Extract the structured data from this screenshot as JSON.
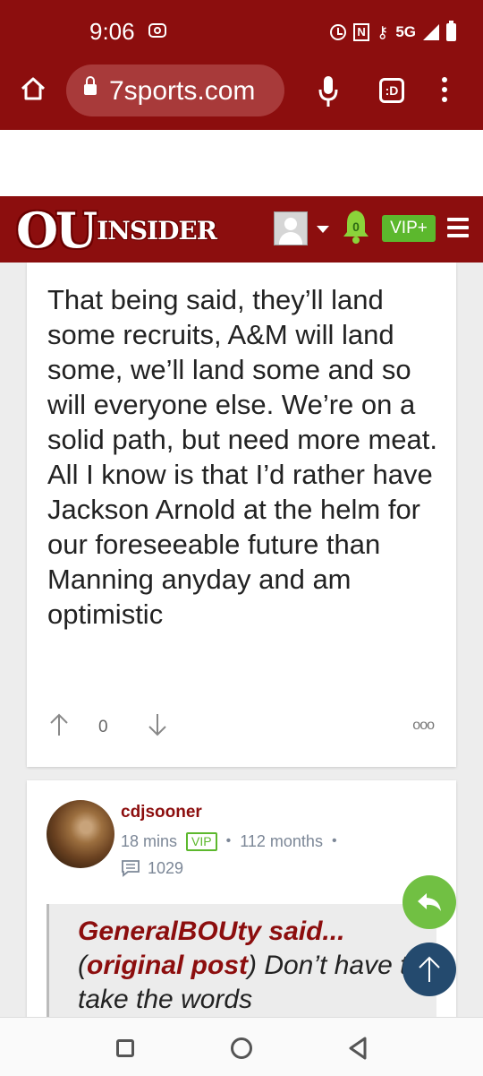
{
  "status_bar": {
    "time": "9:06",
    "network": "5G"
  },
  "browser": {
    "url": "7sports.com",
    "tab_icon_label": ":D"
  },
  "site_header": {
    "logo_ou": "OU",
    "logo_insider": "INSIDER",
    "notification_count": "0",
    "vip_label": "VIP+"
  },
  "post1": {
    "body": "That being said, they’ll land some recruits, A&M will land some, we’ll land some and so will everyone else. We’re on a solid path, but need more meat. All I know is that I’d rather have Jackson Arnold at the helm for our foreseeable future than Manning anyday and am optimistic",
    "vote_count": "0",
    "more_label": "ooo"
  },
  "post2": {
    "author": "cdjsooner",
    "time_ago": "18 mins",
    "vip_tag": "VIP",
    "member_duration": "112 months",
    "post_count": "1029",
    "quote": {
      "author_said": "GeneralBOUty said...",
      "open_paren": "(",
      "original_post_link": "original post",
      "close_paren": ")",
      "text": " Don’t have to take the words"
    }
  },
  "colors": {
    "brand": "#8c0e0e",
    "vip_green": "#5cb82d",
    "scroll_top_button": "#244a6e"
  },
  "icons": [
    "home-icon",
    "lock-icon",
    "mic-icon",
    "tab-icon",
    "menu-icon",
    "bell-icon",
    "hamburger-icon",
    "up-arrow-icon",
    "down-arrow-icon",
    "more-icon",
    "comment-icon",
    "reply-icon",
    "arrow-up-icon"
  ]
}
